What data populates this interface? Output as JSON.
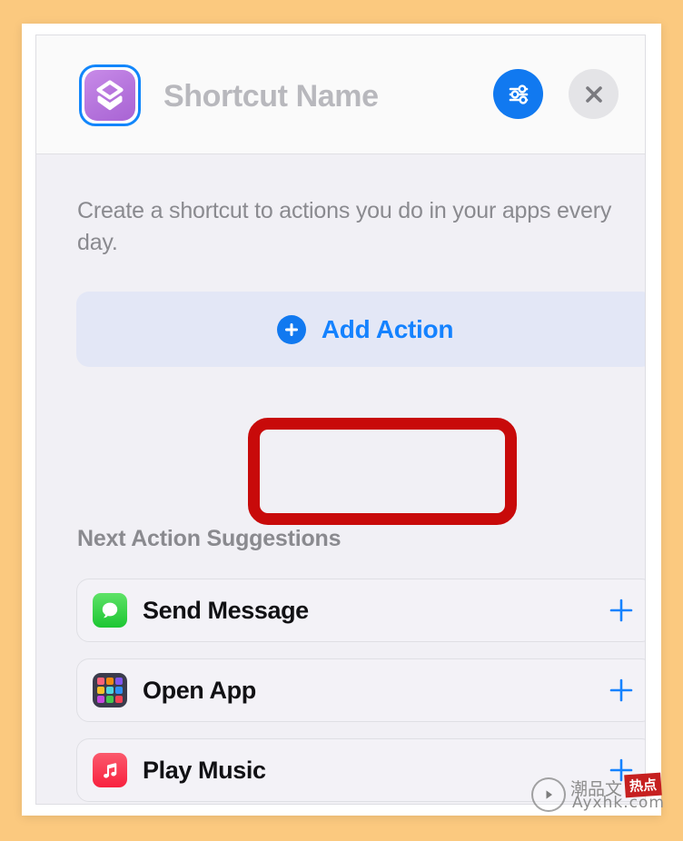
{
  "window": {
    "background_color": "#FBC97F",
    "card_background": "#FFFFFF",
    "panel_background": "#F1F0F5"
  },
  "header": {
    "shortcut_icon_name": "shortcut-app-icon",
    "title": "Shortcut Name",
    "title_color": "#B8B8BD",
    "settings_icon": "sliders-icon",
    "settings_color": "#1179F0",
    "close_icon": "close-x-icon",
    "close_color": "#E4E4E7"
  },
  "body": {
    "description": "Create a shortcut to actions you do in your apps every day."
  },
  "add_action": {
    "plus_icon": "plus-circle-icon",
    "label": "Add Action",
    "label_color": "#1482FF",
    "panel_color": "#E3E7F6"
  },
  "highlight": {
    "name": "red-annotation-box",
    "color": "#C80A0A",
    "border_width_px": 13
  },
  "suggestions": {
    "title": "Next Action Suggestions",
    "items": [
      {
        "label": "Send Message",
        "icon_name": "messages-app-icon",
        "icon_color": "#1CC632",
        "action_icon": "plus-icon"
      },
      {
        "label": "Open App",
        "icon_name": "open-app-grid-icon",
        "icon_color": "#3B3C4C",
        "action_icon": "plus-icon"
      },
      {
        "label": "Play Music",
        "icon_name": "music-app-icon",
        "icon_color": "#F8213E",
        "action_icon": "plus-icon"
      }
    ]
  },
  "watermark": {
    "play_icon": "play-button-icon",
    "chinese_text": "潮品文",
    "stamp_text": "热点",
    "url": "Ayxhk.com"
  }
}
